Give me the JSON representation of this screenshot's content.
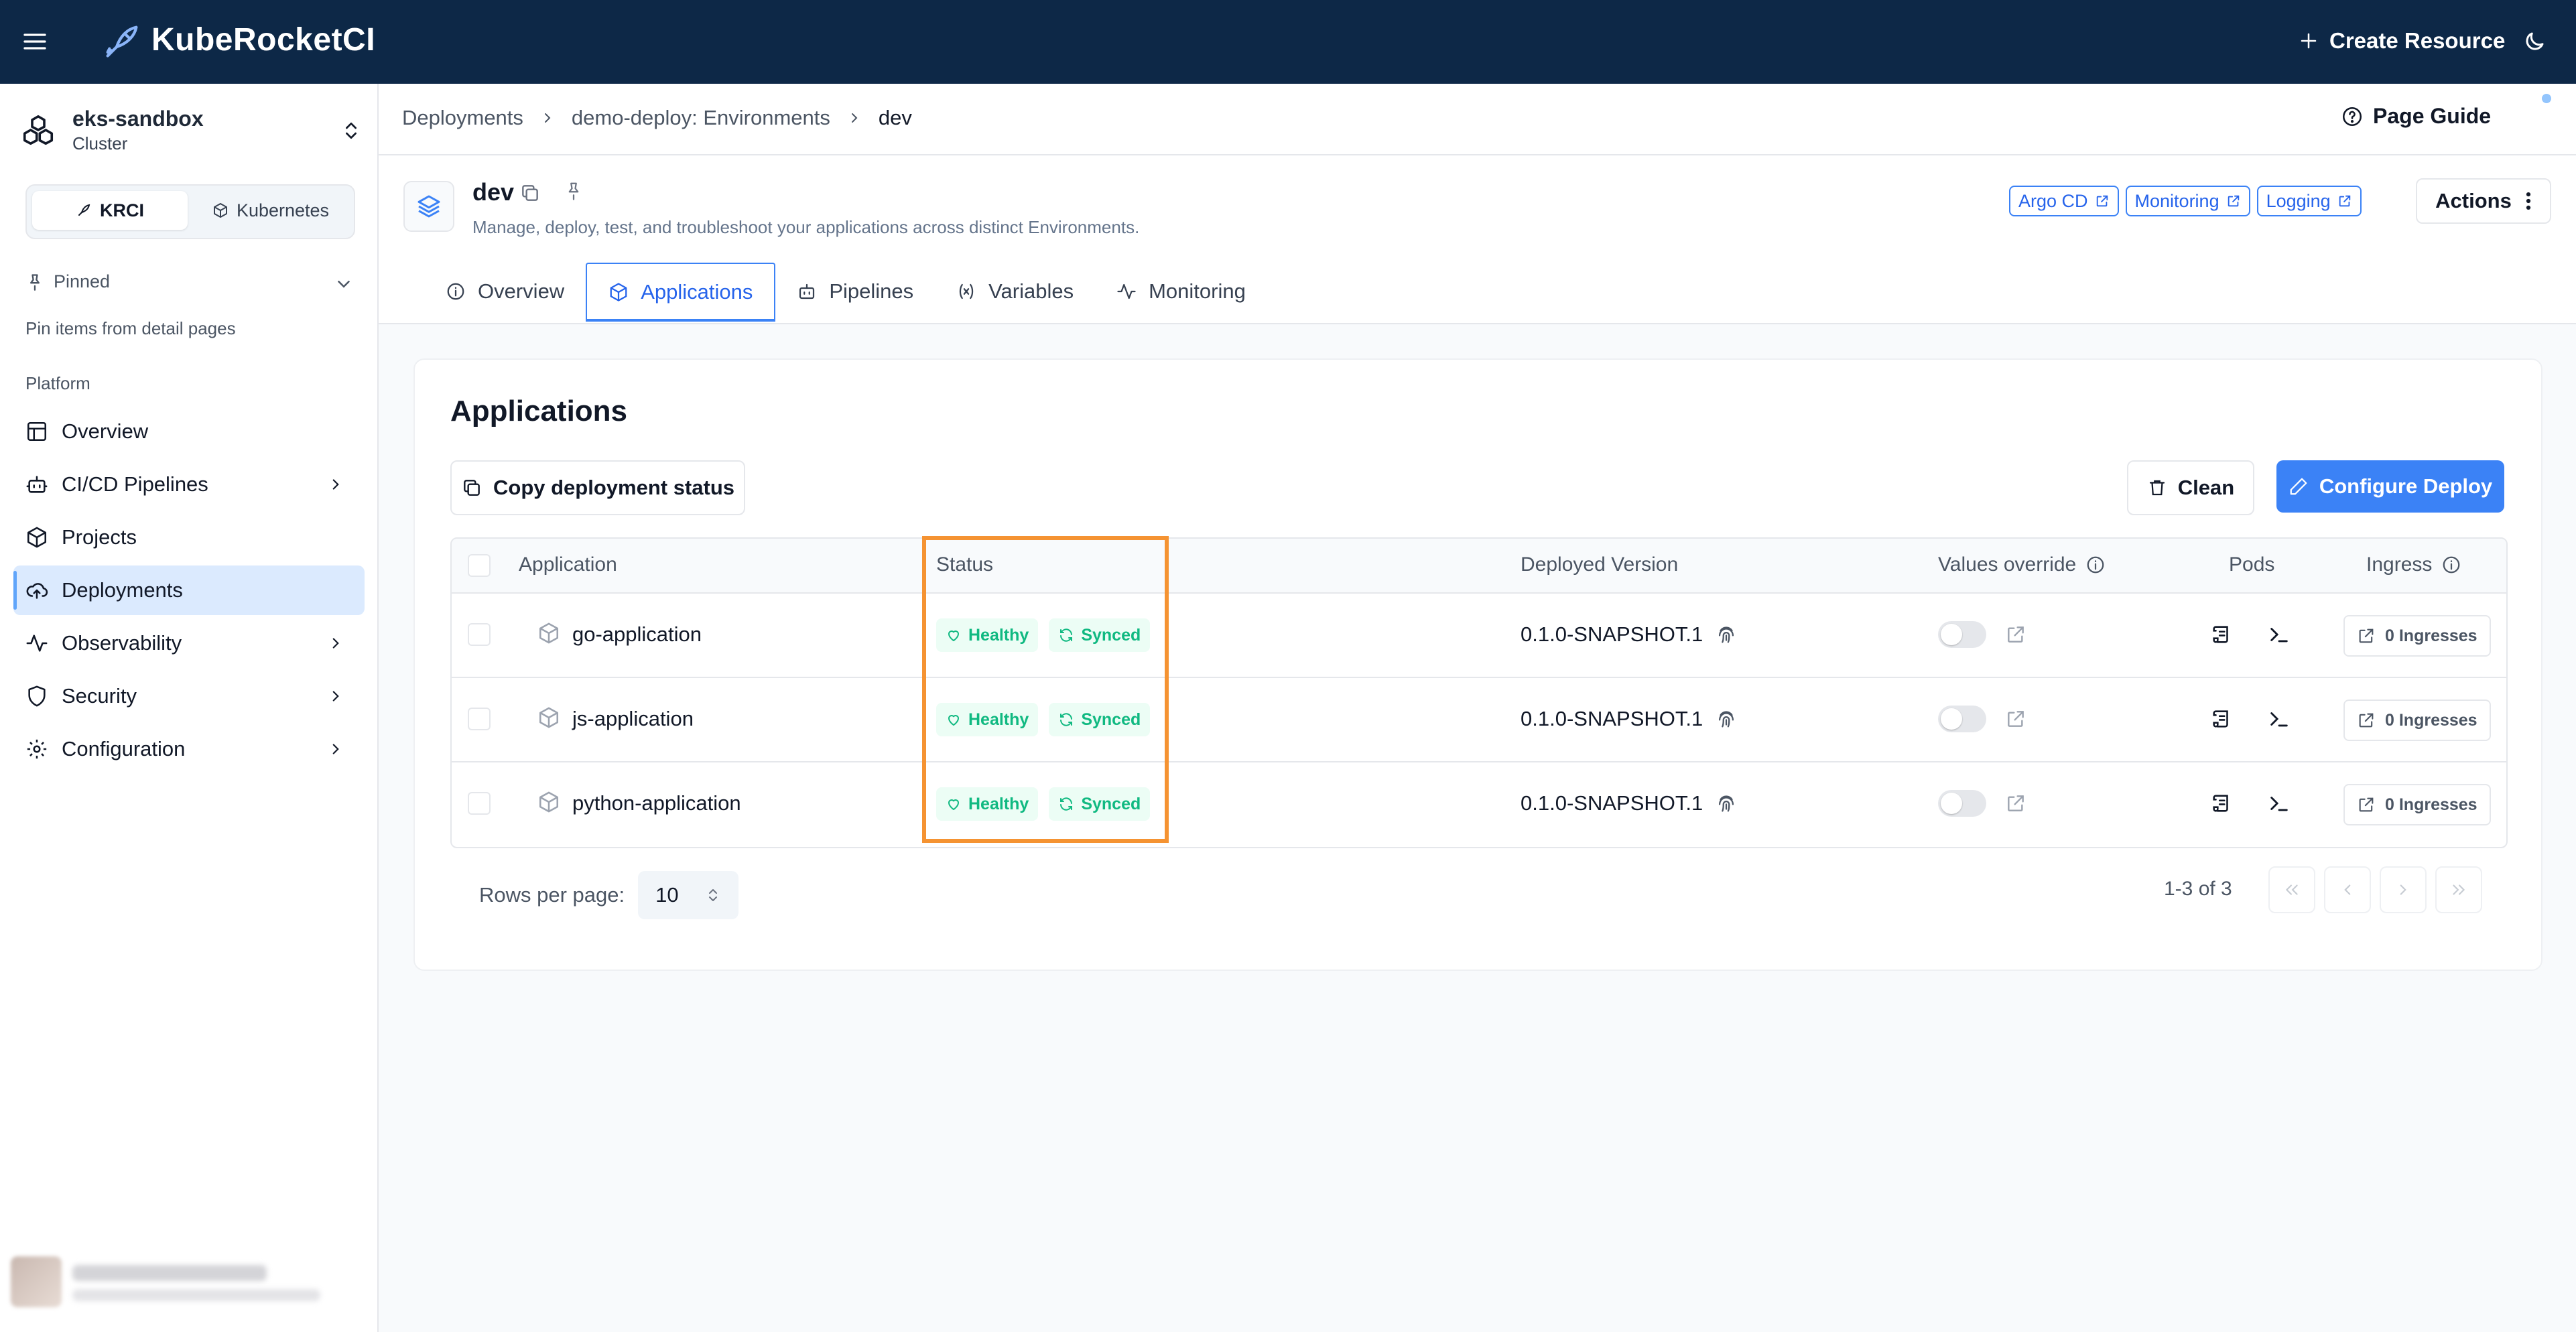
{
  "topbar": {
    "brand": "KubeRocketCI",
    "create_label": "Create Resource"
  },
  "sidebar": {
    "cluster": {
      "name": "eks-sandbox",
      "type": "Cluster"
    },
    "modes": [
      "KRCI",
      "Kubernetes"
    ],
    "pinned": {
      "title": "Pinned",
      "hint": "Pin items from detail pages"
    },
    "section_label": "Platform",
    "items": [
      {
        "label": "Overview",
        "icon": "layout-icon"
      },
      {
        "label": "CI/CD Pipelines",
        "icon": "bot-icon"
      },
      {
        "label": "Projects",
        "icon": "box-icon"
      },
      {
        "label": "Deployments",
        "icon": "cloud-upload-icon"
      },
      {
        "label": "Observability",
        "icon": "activity-icon"
      },
      {
        "label": "Security",
        "icon": "shield-icon"
      },
      {
        "label": "Configuration",
        "icon": "gear-icon"
      }
    ]
  },
  "breadcrumb": {
    "items": [
      "Deployments",
      "demo-deploy: Environments"
    ],
    "current": "dev"
  },
  "page_guide": "Page Guide",
  "env": {
    "name": "dev",
    "description": "Manage, deploy, test, and troubleshoot your applications across distinct Environments.",
    "links": [
      "Argo CD",
      "Monitoring",
      "Logging"
    ],
    "actions_label": "Actions"
  },
  "tabs": [
    "Overview",
    "Applications",
    "Pipelines",
    "Variables",
    "Monitoring"
  ],
  "applications": {
    "title": "Applications",
    "copy_button": "Copy deployment status",
    "clean_button": "Clean",
    "configure_button": "Configure Deploy",
    "columns": [
      "Application",
      "Status",
      "Deployed Version",
      "Values override",
      "Pods",
      "Ingress"
    ],
    "rows": [
      {
        "name": "go-application",
        "health": "Healthy",
        "sync": "Synced",
        "version": "0.1.0-SNAPSHOT.1",
        "ingress": "0 Ingresses"
      },
      {
        "name": "js-application",
        "health": "Healthy",
        "sync": "Synced",
        "version": "0.1.0-SNAPSHOT.1",
        "ingress": "0 Ingresses"
      },
      {
        "name": "python-application",
        "health": "Healthy",
        "sync": "Synced",
        "version": "0.1.0-SNAPSHOT.1",
        "ingress": "0 Ingresses"
      }
    ],
    "pagination": {
      "rows_label": "Rows per page:",
      "rows_value": "10",
      "range": "1-3 of 3"
    }
  },
  "colors": {
    "topbar": "#0d2847",
    "accent": "#3b82f6",
    "healthy": "#10b981",
    "highlight": "#f59332"
  }
}
